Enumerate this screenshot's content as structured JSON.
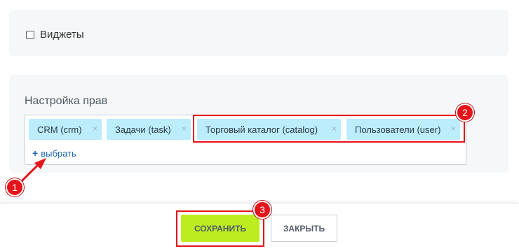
{
  "widgets": {
    "label": "Виджеты",
    "checked": false
  },
  "rights": {
    "title": "Настройка прав",
    "tags": [
      {
        "label": "CRM (crm)"
      },
      {
        "label": "Задачи (task)"
      },
      {
        "label": "Торговый каталог (catalog)"
      },
      {
        "label": "Пользователи (user)"
      }
    ],
    "remove_glyph": "×",
    "add_plus": "+",
    "add_label": "выбрать"
  },
  "footer": {
    "save_label": "СОХРАНИТЬ",
    "close_label": "ЗАКРЫТЬ"
  },
  "annotations": {
    "badge1": "1",
    "badge2": "2",
    "badge3": "3",
    "highlight_color": "#e4141b"
  },
  "colors": {
    "tag_bg": "#bcedfc",
    "save_bg": "#bbed21",
    "link": "#2067b0",
    "panel_bg": "#f5f7f8"
  }
}
